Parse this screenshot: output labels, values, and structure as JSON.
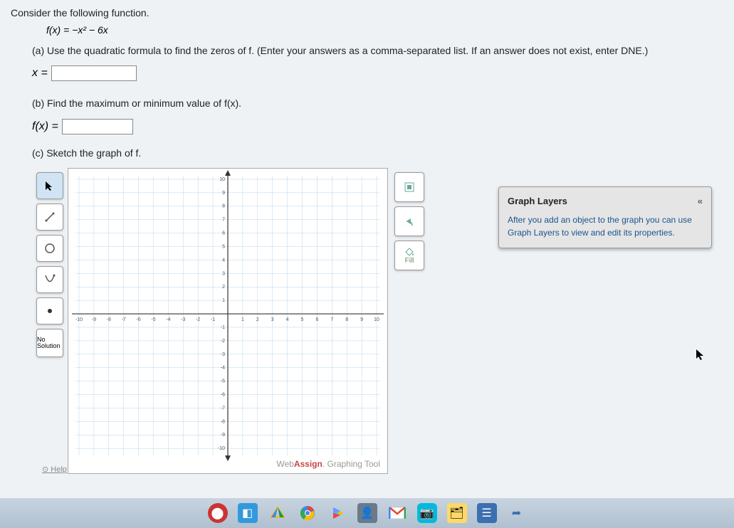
{
  "question": {
    "intro": "Consider the following function.",
    "formula": "f(x) = −x² − 6x",
    "partA": "(a) Use the quadratic formula to find the zeros of f. (Enter your answers as a comma-separated list. If an answer does not exist, enter DNE.)",
    "partA_prefix": "x =",
    "partA_value": "",
    "partB": "(b) Find the maximum or minimum value of f(x).",
    "partB_prefix": "f(x) =",
    "partB_value": "",
    "partC": "(c) Sketch the graph of f."
  },
  "tools": {
    "pointer": "↖",
    "line": "↗",
    "circle": "○",
    "parabola": "∪",
    "point": "•",
    "no_solution": "No Solution"
  },
  "right_tools": {
    "zoom": "⊡",
    "undo": "↶",
    "fill_icon": "🪣",
    "fill_label": "Fill"
  },
  "layers": {
    "title": "Graph Layers",
    "collapse": "«",
    "body": "After you add an object to the graph you can use Graph Layers to view and edit its properties."
  },
  "help": "Help",
  "watermark_prefix": "Web",
  "watermark_bold": "Assign",
  "watermark_suffix": ". Graphing Tool",
  "chart_data": {
    "type": "scatter",
    "title": "",
    "xlabel": "",
    "ylabel": "",
    "xlim": [
      -10,
      10
    ],
    "ylim": [
      -10,
      10
    ],
    "x_ticks": [
      -10,
      -9,
      -8,
      -7,
      -6,
      -5,
      -4,
      -3,
      -2,
      -1,
      1,
      2,
      3,
      4,
      5,
      6,
      7,
      8,
      9,
      10
    ],
    "y_ticks": [
      -10,
      -9,
      -8,
      -7,
      -6,
      -5,
      -4,
      -3,
      -2,
      -1,
      1,
      2,
      3,
      4,
      5,
      6,
      7,
      8,
      9,
      10
    ],
    "series": []
  },
  "taskbar_icons": [
    "rec",
    "cam",
    "drive",
    "chrome",
    "play",
    "contact",
    "gmail",
    "camera2",
    "explorer",
    "notes",
    "share"
  ]
}
